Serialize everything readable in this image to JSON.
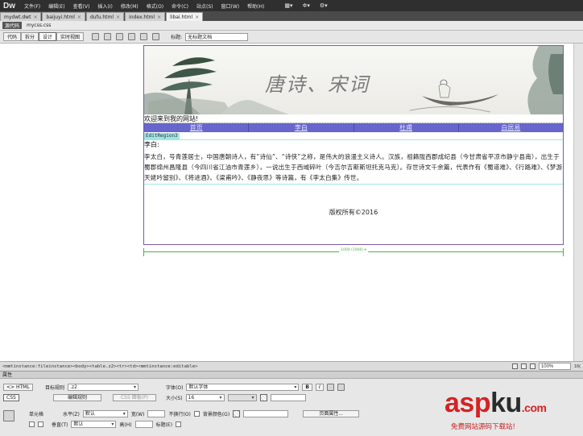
{
  "app": {
    "logo": "Dw",
    "menu": [
      "文件(F)",
      "编辑(E)",
      "查看(V)",
      "插入(I)",
      "修改(M)",
      "格式(O)",
      "命令(C)",
      "站点(S)",
      "窗口(W)",
      "帮助(H)"
    ],
    "tools": [
      "▦▾",
      "✲▾",
      "⚙▾"
    ]
  },
  "tabs": [
    {
      "label": "mydwt.dwt",
      "close": "×"
    },
    {
      "label": "baijuyi.html",
      "close": "×"
    },
    {
      "label": "dufu.html",
      "close": "×"
    },
    {
      "label": "index.html",
      "close": "×"
    },
    {
      "label": "libai.html",
      "close": "×",
      "active": true
    }
  ],
  "related_files": {
    "source_code": "源代码",
    "css_file": "mycss.css"
  },
  "doc_toolbar": {
    "views": [
      "代码",
      "拆分",
      "设计",
      "实时视图"
    ],
    "active_view": "设计",
    "title_label": "标题:",
    "title_value": "无标题文档"
  },
  "page": {
    "banner_title": "唐诗、宋词",
    "welcome": "欢迎来到我的网站!",
    "nav": [
      "首页",
      "李白",
      "杜甫",
      "白居易"
    ],
    "region_name": "EditRegion3",
    "poet_heading": "李白:",
    "poet_body": "李太白，号青莲居士，中国唐朝诗人，有“诗仙”、“诗侠”之称，是伟大的浪漫主义诗人。汉族，祖籍陇西郡成纪县（今甘肃省平凉市静宁县南），出生于蜀郡绵州昌隆县（今四川省江油市青莲乡），一说出生于西域碎叶（今吉尔吉斯斯坦托克马克）。存世诗文千余篇，代表作有《蜀道难》、《行路难》、《梦游天姥吟留别》、《将进酒》、《梁甫吟》、《静夜思》等诗篇，有《李太白集》传世。",
    "footer": "版权所有©2016",
    "table_width_label": "1000 (1000) ▾"
  },
  "statusbar": {
    "tag_path": "<mmtinstance:fileinstance><body><table.z2><tr><td><mmtinstance:editable>",
    "zoom": "100%",
    "size_readout": "16("
  },
  "properties": {
    "header": "属性",
    "html_btn": "<> HTML",
    "css_btn": "CSS",
    "target_rule_label": "目标规则",
    "target_rule_value": ".z2",
    "edit_rule_btn": "编辑规则",
    "css_panel_btn": "CSS 面板(P)",
    "font_label": "字体(O)",
    "font_value": "默认字体",
    "bold_btn": "B",
    "italic_btn": "I",
    "size_label": "大小(S)",
    "size_value": "16",
    "cell_label": "单元格",
    "horz_label": "水平(Z)",
    "horz_value": "默认",
    "vert_label": "垂直(T)",
    "vert_value": "默认",
    "width_label": "宽(W)",
    "height_label": "高(H)",
    "nowrap_label": "不换行(O)",
    "header_label": "标题(E)",
    "bg_label": "背景颜色(G)",
    "page_props_btn": "页面属性..."
  },
  "watermark": {
    "logo_asp": "asp",
    "logo_ku": "ku",
    "logo_tld": ".com",
    "subtitle": "免费网站源码下载站!"
  },
  "colors": {
    "nav_bg": "#6666cc",
    "region_tab": "#9ee7e4",
    "watermark_red": "#d42323",
    "watermark_dark": "#2b2b2b"
  }
}
